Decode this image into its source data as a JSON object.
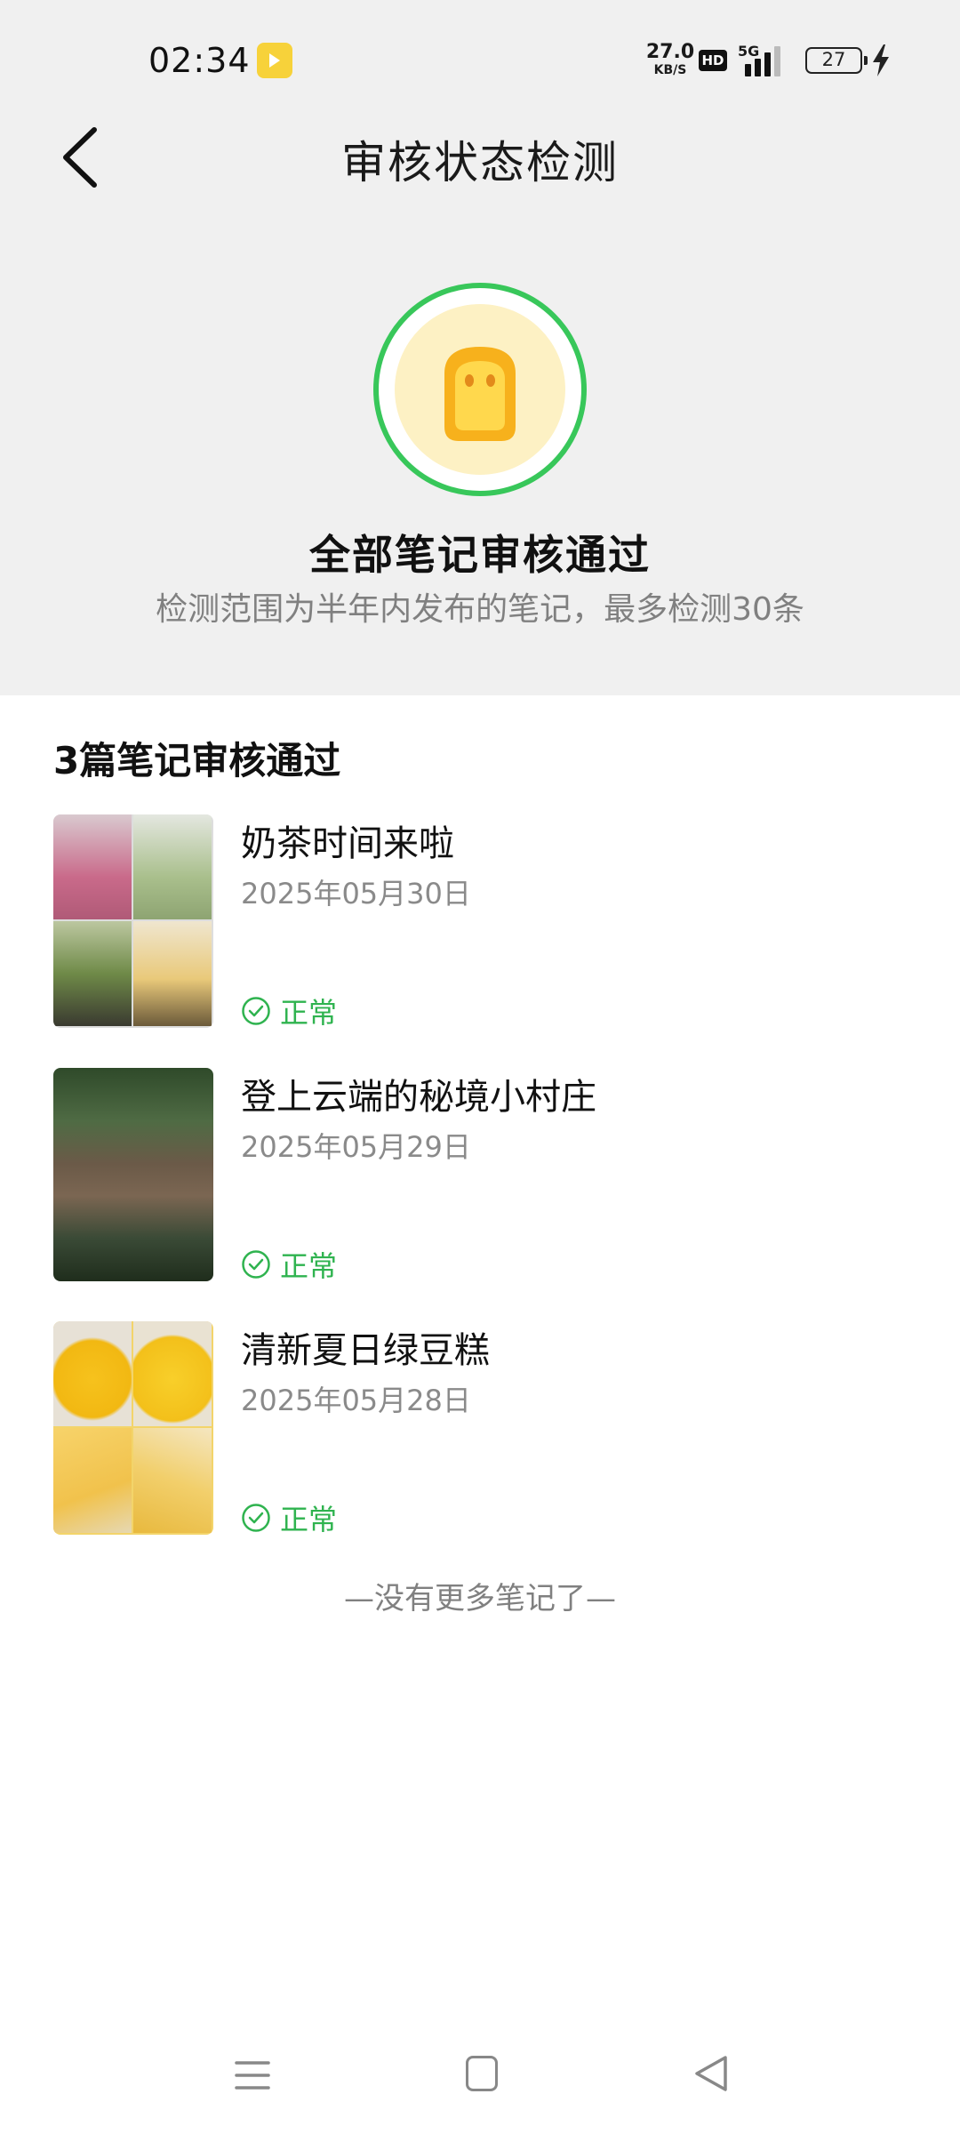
{
  "status_bar": {
    "time": "02:34",
    "net_speed_value": "27.0",
    "net_speed_unit": "KB/S",
    "hd_label": "HD",
    "network_type": "5G",
    "battery": "27"
  },
  "header": {
    "title": "审核状态检测"
  },
  "hero": {
    "title": "全部笔记审核通过",
    "subtitle": "检测范围为半年内发布的笔记，最多检测30条",
    "ring_color": "#38c75a"
  },
  "list": {
    "heading": "3篇笔记审核通过",
    "items": [
      {
        "title": "奶茶时间来啦",
        "date": "2025年05月30日",
        "status": "正常"
      },
      {
        "title": "登上云端的秘境小村庄",
        "date": "2025年05月29日",
        "status": "正常"
      },
      {
        "title": "清新夏日绿豆糕",
        "date": "2025年05月28日",
        "status": "正常"
      }
    ],
    "end_text": "—没有更多笔记了—"
  },
  "colors": {
    "accent_green": "#2fb34f",
    "top_background": "#f0f0f0"
  },
  "icons": {
    "back": "chevron-left-icon",
    "status": "check-circle-icon",
    "nav": [
      "menu-icon",
      "home-square-icon",
      "back-triangle-icon"
    ]
  }
}
